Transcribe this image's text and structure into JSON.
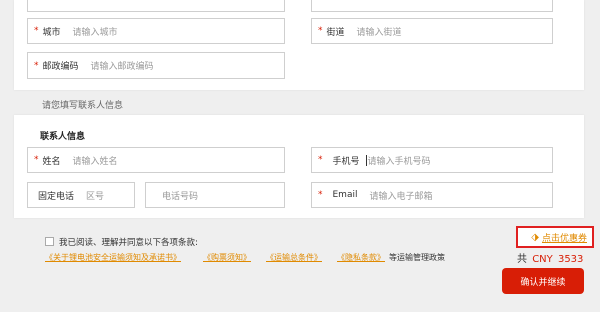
{
  "address": {
    "city": {
      "label": "城市",
      "placeholder": "请输入城市"
    },
    "street": {
      "label": "街道",
      "placeholder": "请输入街道"
    },
    "postal": {
      "label": "邮政编码",
      "placeholder": "请输入邮政编码"
    }
  },
  "contact_hint": "请您填写联系人信息",
  "contact": {
    "title": "联系人信息",
    "name": {
      "label": "姓名",
      "placeholder": "请输入姓名"
    },
    "phone": {
      "label": "手机号",
      "placeholder": "请输入手机号码"
    },
    "landline": {
      "label": "固定电话",
      "area_placeholder": "区号",
      "number_placeholder": "电话号码"
    },
    "email": {
      "label": "Email",
      "placeholder": "请输入电子邮箱"
    }
  },
  "terms": {
    "intro": "我已阅读、理解并同意以下各项条款:",
    "links": [
      "《关于锂电池安全运输须知及承诺书》",
      "《购票须知》",
      "《运输总条件》",
      "《隐私条款》"
    ],
    "suffix": "等运输管理政策"
  },
  "coupon_label": "点击优惠券",
  "total": {
    "prefix": "共",
    "currency": "CNY",
    "amount": "3533"
  },
  "submit_label": "确认并继续",
  "colors": {
    "accent": "#d81e06",
    "link": "#e08a00",
    "highlight_border": "#e02020"
  }
}
